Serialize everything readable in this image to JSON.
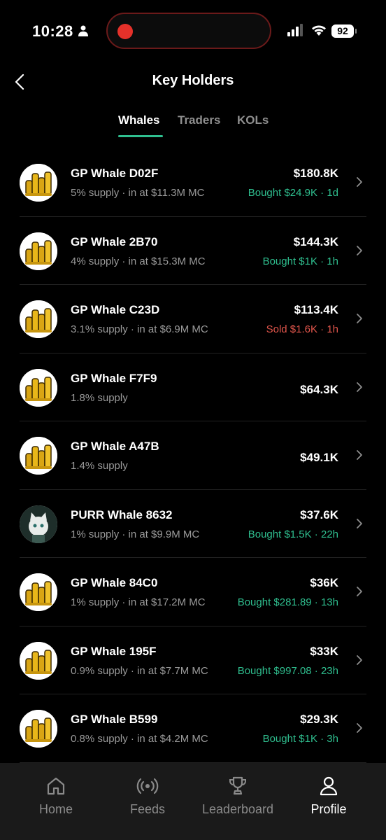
{
  "status_bar": {
    "time": "10:28",
    "battery": "92"
  },
  "header": {
    "title": "Key Holders"
  },
  "tabs": [
    {
      "label": "Whales",
      "active": true
    },
    {
      "label": "Traders",
      "active": false
    },
    {
      "label": "KOLs",
      "active": false
    }
  ],
  "holders": [
    {
      "name": "GP Whale D02F",
      "supply": "5% supply · in at $11.3M MC",
      "value": "$180.8K",
      "activity": "Bought $24.9K · 1d",
      "activity_type": "buy",
      "avatar_icon": "gold-coins-icon"
    },
    {
      "name": "GP Whale 2B70",
      "supply": "4% supply · in at $15.3M MC",
      "value": "$144.3K",
      "activity": "Bought $1K · 1h",
      "activity_type": "buy",
      "avatar_icon": "gold-coins-icon"
    },
    {
      "name": "GP Whale C23D",
      "supply": "3.1% supply · in at $6.9M MC",
      "value": "$113.4K",
      "activity": "Sold $1.6K · 1h",
      "activity_type": "sell",
      "avatar_icon": "gold-coins-icon"
    },
    {
      "name": "GP Whale F7F9",
      "supply": "1.8% supply",
      "value": "$64.3K",
      "activity": "",
      "activity_type": "none",
      "avatar_icon": "gold-coins-icon"
    },
    {
      "name": "GP Whale A47B",
      "supply": "1.4% supply",
      "value": "$49.1K",
      "activity": "",
      "activity_type": "none",
      "avatar_icon": "gold-coins-icon"
    },
    {
      "name": "PURR Whale 8632",
      "supply": "1% supply · in at $9.9M MC",
      "value": "$37.6K",
      "activity": "Bought $1.5K · 22h",
      "activity_type": "buy",
      "avatar_icon": "cat-avatar-icon"
    },
    {
      "name": "GP Whale 84C0",
      "supply": "1% supply · in at $17.2M MC",
      "value": "$36K",
      "activity": "Bought $281.89 · 13h",
      "activity_type": "buy",
      "avatar_icon": "gold-coins-icon"
    },
    {
      "name": "GP Whale 195F",
      "supply": "0.9% supply · in at $7.7M MC",
      "value": "$33K",
      "activity": "Bought $997.08 · 23h",
      "activity_type": "buy",
      "avatar_icon": "gold-coins-icon"
    },
    {
      "name": "GP Whale B599",
      "supply": "0.8% supply · in at $4.2M MC",
      "value": "$29.3K",
      "activity": "Bought $1K · 3h",
      "activity_type": "buy",
      "avatar_icon": "gold-coins-icon"
    }
  ],
  "bottom_nav": [
    {
      "label": "Home",
      "icon": "home-icon",
      "active": false
    },
    {
      "label": "Feeds",
      "icon": "broadcast-icon",
      "active": false
    },
    {
      "label": "Leaderboard",
      "icon": "trophy-icon",
      "active": false
    },
    {
      "label": "Profile",
      "icon": "user-icon",
      "active": true
    }
  ],
  "colors": {
    "accent": "#2fbf8f",
    "sell": "#e0554b",
    "background": "#000000",
    "nav_background": "#1a1a1a"
  }
}
